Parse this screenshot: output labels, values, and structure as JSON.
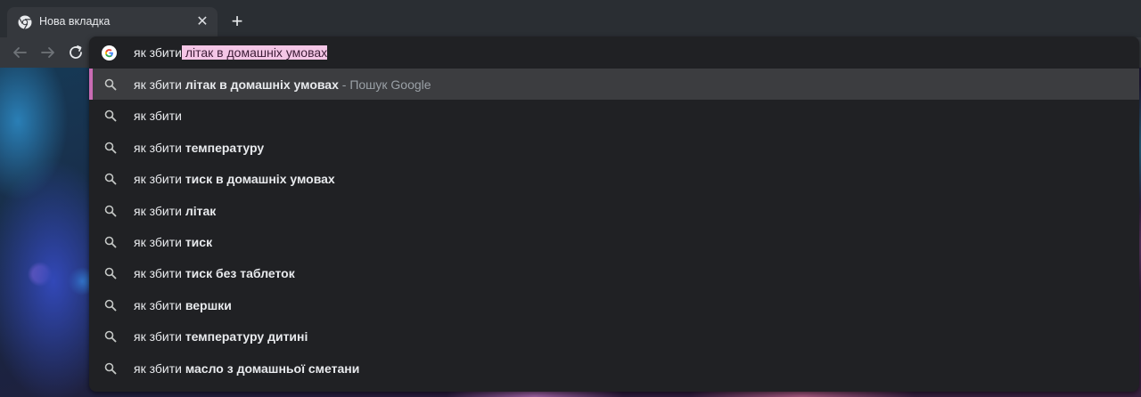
{
  "tab": {
    "title": "Нова вкладка",
    "close_glyph": "✕"
  },
  "new_tab_glyph": "+",
  "omnibox": {
    "typed": "як збити",
    "autocomplete": " літак в домашніх умовах"
  },
  "suggestions": [
    {
      "prefix": "як збити",
      "bold": " літак в домашніх умовах",
      "suffix": " - Пошук Google",
      "selected": true
    },
    {
      "prefix": "як збити",
      "bold": "",
      "suffix": ""
    },
    {
      "prefix": "як збити",
      "bold": " температуру",
      "suffix": ""
    },
    {
      "prefix": "як збити",
      "bold": " тиск в домашніх умовах",
      "suffix": ""
    },
    {
      "prefix": "як збити",
      "bold": " літак",
      "suffix": ""
    },
    {
      "prefix": "як збити",
      "bold": " тиск",
      "suffix": ""
    },
    {
      "prefix": "як збити",
      "bold": " тиск без таблеток",
      "suffix": ""
    },
    {
      "prefix": "як збити",
      "bold": " вершки",
      "suffix": ""
    },
    {
      "prefix": "як збити",
      "bold": " температуру дитині",
      "suffix": ""
    },
    {
      "prefix": "як збити",
      "bold": " масло з домашньої сметани",
      "suffix": ""
    }
  ],
  "colors": {
    "accent": "#c96bb3",
    "selection": "#f4c6e6"
  }
}
